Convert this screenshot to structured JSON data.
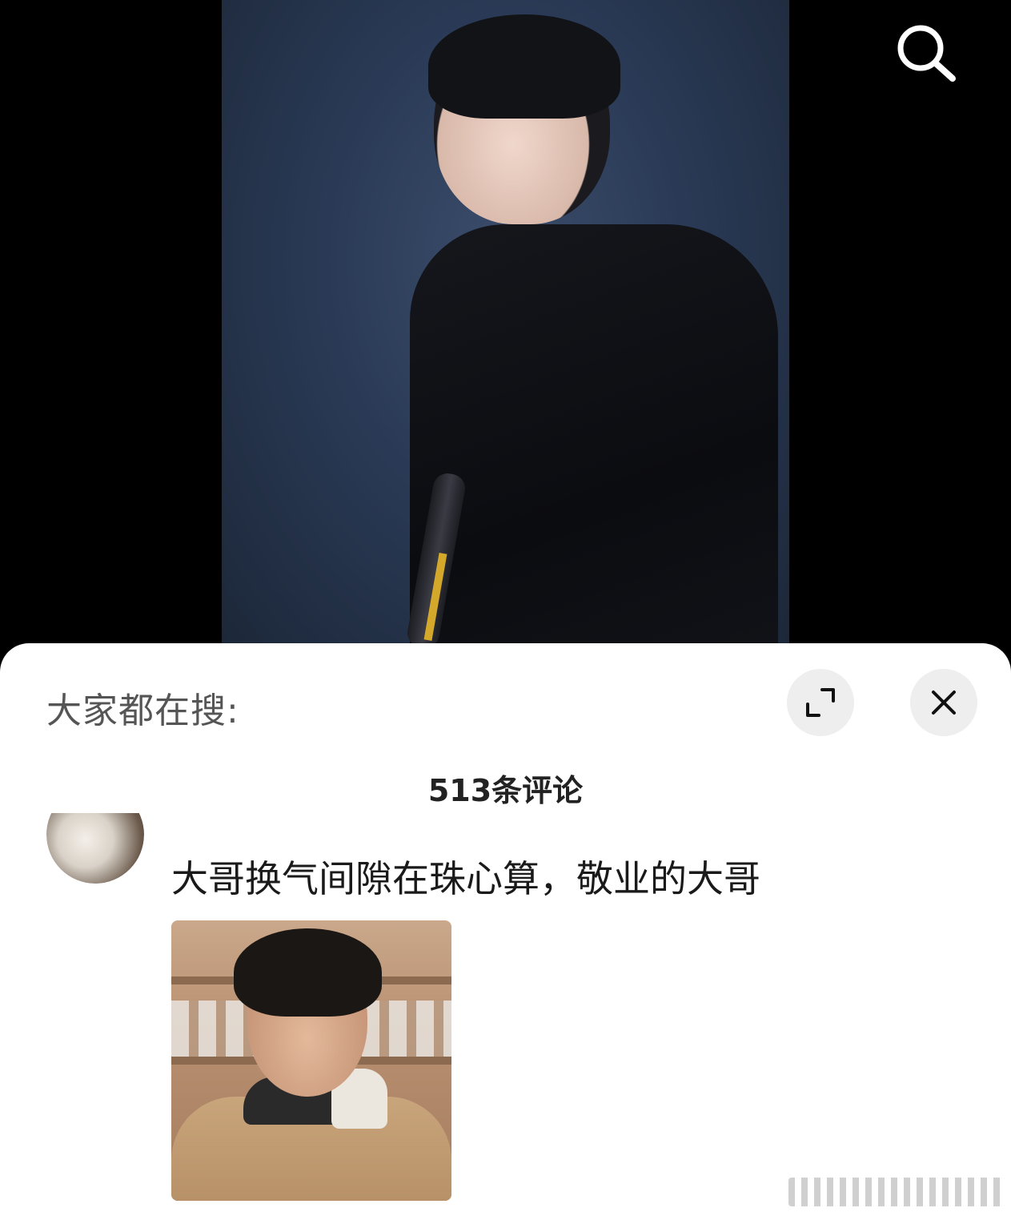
{
  "header": {
    "search_icon": "search-icon"
  },
  "sheet": {
    "title": "大家都在搜:",
    "expand_icon": "expand-icon",
    "close_icon": "close-icon",
    "comment_count": "513条评论"
  },
  "comments": [
    {
      "text": "大哥换气间隙在珠心算，敬业的大哥"
    }
  ]
}
